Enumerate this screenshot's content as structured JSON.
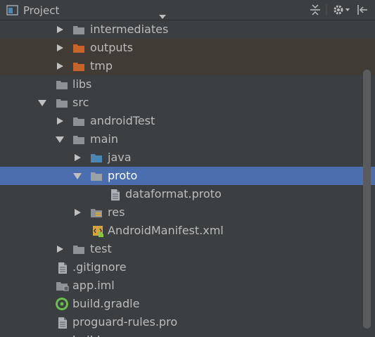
{
  "toolbar": {
    "title": "Project",
    "dropdown_icon": "triangle-down-icon",
    "icons": [
      "collapse-all-icon",
      "gear-icon",
      "hide-icon"
    ]
  },
  "colors": {
    "background": "#3c3f41",
    "selection": "#4b6eaf",
    "excluded_row": "#403c35",
    "folder": "#8e9295",
    "excluded_folder": "#c7642c",
    "source_folder": "#4b87b1"
  },
  "tree": {
    "items": [
      {
        "label": "intermediates",
        "expanded": false,
        "icon": "folder-icon"
      },
      {
        "label": "outputs",
        "expanded": false,
        "icon": "excluded-folder-icon"
      },
      {
        "label": "tmp",
        "expanded": false,
        "icon": "excluded-folder-icon"
      },
      {
        "label": "libs",
        "icon": "folder-icon"
      },
      {
        "label": "src",
        "expanded": true,
        "icon": "folder-icon"
      },
      {
        "label": "androidTest",
        "expanded": false,
        "icon": "folder-icon"
      },
      {
        "label": "main",
        "expanded": true,
        "icon": "folder-icon"
      },
      {
        "label": "java",
        "expanded": false,
        "icon": "source-folder-icon"
      },
      {
        "label": "proto",
        "expanded": true,
        "icon": "folder-icon",
        "selected": true
      },
      {
        "label": "dataformat.proto",
        "icon": "file-icon"
      },
      {
        "label": "res",
        "expanded": false,
        "icon": "resource-folder-icon"
      },
      {
        "label": "AndroidManifest.xml",
        "icon": "android-manifest-icon"
      },
      {
        "label": "test",
        "expanded": false,
        "icon": "folder-icon"
      },
      {
        "label": ".gitignore",
        "icon": "file-icon"
      },
      {
        "label": "app.iml",
        "icon": "module-file-icon"
      },
      {
        "label": "build.gradle",
        "icon": "gradle-icon"
      },
      {
        "label": "proguard-rules.pro",
        "icon": "file-icon"
      },
      {
        "label": "build",
        "icon": "folder-icon"
      }
    ]
  }
}
